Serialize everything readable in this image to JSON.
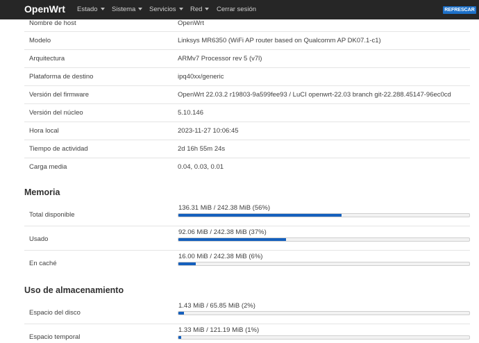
{
  "nav": {
    "brand": "OpenWrt",
    "items": [
      "Estado",
      "Sistema",
      "Servicios",
      "Red"
    ],
    "logout": "Cerrar sesión",
    "refresh": "REFRESCAR"
  },
  "system": {
    "rows": [
      {
        "label": "Nombre de host",
        "value": "OpenWrt"
      },
      {
        "label": "Modelo",
        "value": "Linksys MR6350 (WiFi AP router based on Qualcomm AP DK07.1-c1)"
      },
      {
        "label": "Arquitectura",
        "value": "ARMv7 Processor rev 5 (v7l)"
      },
      {
        "label": "Plataforma de destino",
        "value": "ipq40xx/generic"
      },
      {
        "label": "Versión del firmware",
        "value": "OpenWrt 22.03.2 r19803-9a599fee93 / LuCI openwrt-22.03 branch git-22.288.45147-96ec0cd"
      },
      {
        "label": "Versión del núcleo",
        "value": "5.10.146"
      },
      {
        "label": "Hora local",
        "value": "2023-11-27 10:06:45"
      },
      {
        "label": "Tiempo de actividad",
        "value": "2d 16h 55m 24s"
      },
      {
        "label": "Carga media",
        "value": "0.04, 0.03, 0.01"
      }
    ]
  },
  "memory": {
    "title": "Memoria",
    "rows": [
      {
        "label": "Total disponible",
        "text": "136.31 MiB / 242.38 MiB (56%)",
        "percent": 56
      },
      {
        "label": "Usado",
        "text": "92.06 MiB / 242.38 MiB (37%)",
        "percent": 37
      },
      {
        "label": "En caché",
        "text": "16.00 MiB / 242.38 MiB (6%)",
        "percent": 6
      }
    ]
  },
  "storage": {
    "title": "Uso de almacenamiento",
    "rows": [
      {
        "label": "Espacio del disco",
        "text": "1.43 MiB / 65.85 MiB (2%)",
        "percent": 2
      },
      {
        "label": "Espacio temporal",
        "text": "1.33 MiB / 121.19 MiB (1%)",
        "percent": 1
      }
    ]
  },
  "colors": {
    "navbar": "#262626",
    "accent": "#1560bd",
    "refresh": "#1d70c8"
  }
}
